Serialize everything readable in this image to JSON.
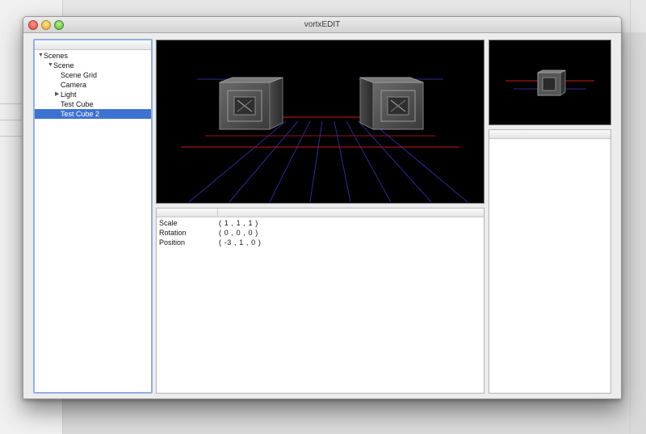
{
  "window": {
    "title": "vortxEDIT"
  },
  "scene_tree": {
    "header": "",
    "items": [
      {
        "label": "Scenes",
        "expanded": true,
        "selected": false
      },
      {
        "label": "Scene",
        "expanded": true,
        "selected": false
      },
      {
        "label": "Scene Grid",
        "selected": false
      },
      {
        "label": "Camera",
        "selected": false
      },
      {
        "label": "Light",
        "expanded": false,
        "selected": false
      },
      {
        "label": "Test Cube",
        "selected": false
      },
      {
        "label": "Test Cube 2",
        "selected": true
      }
    ]
  },
  "properties": {
    "rows": [
      {
        "name": "Scale",
        "value": "( 1 , 1 , 1 )"
      },
      {
        "name": "Rotation",
        "value": "( 0 , 0 , 0 )"
      },
      {
        "name": "Position",
        "value": "( -3 , 1 , 0 )"
      }
    ]
  },
  "colors": {
    "selection": "#3d73d0",
    "focus_ring": "#8fb1e0",
    "grid_red": "#c81818",
    "grid_blue": "#2a2a9a",
    "viewport_bg": "#000000"
  }
}
